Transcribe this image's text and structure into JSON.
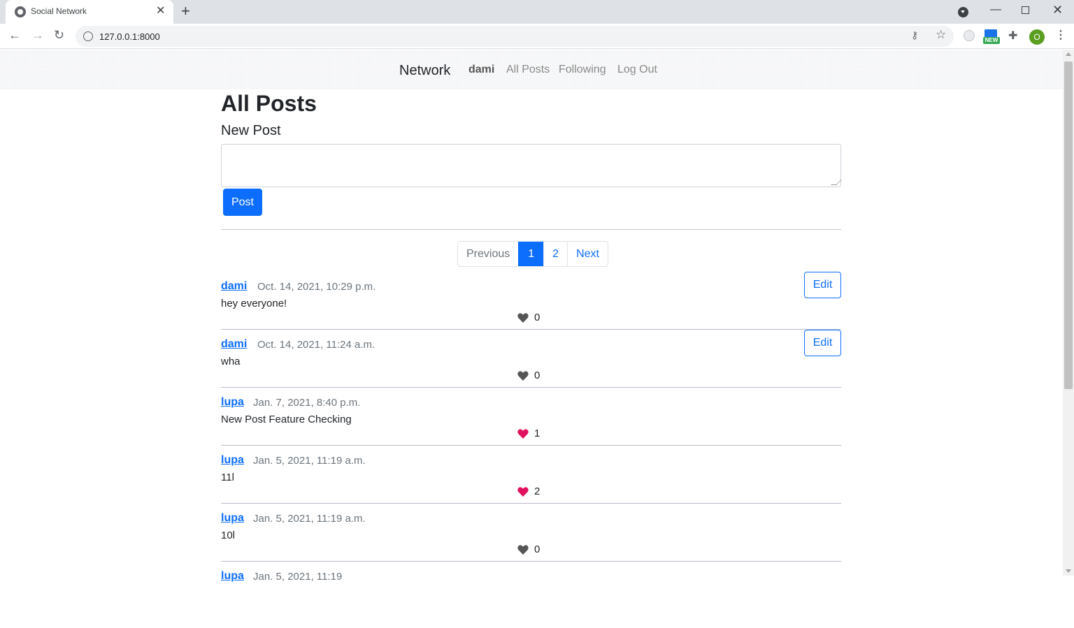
{
  "browser": {
    "tab_title": "Social Network",
    "tab_close": "✕",
    "new_tab": "+",
    "url": "127.0.0.1:8000",
    "ext_new_label": "NEW",
    "profile_initial": "O"
  },
  "navbar": {
    "brand": "Network",
    "user": "dami",
    "links": [
      "All Posts",
      "Following",
      "Log Out"
    ]
  },
  "page": {
    "title": "All Posts",
    "new_post_heading": "New Post",
    "textarea_value": "",
    "post_button": "Post"
  },
  "pagination": {
    "previous": "Previous",
    "pages": [
      "1",
      "2"
    ],
    "active_page": "1",
    "next": "Next"
  },
  "posts": [
    {
      "author": "dami",
      "date": "Oct. 14, 2021, 10:29 p.m.",
      "content": "hey everyone!",
      "likes": "0",
      "liked": false,
      "editable": true,
      "edit_label": "Edit"
    },
    {
      "author": "dami",
      "date": "Oct. 14, 2021, 11:24 a.m.",
      "content": "wha",
      "likes": "0",
      "liked": false,
      "editable": true,
      "edit_label": "Edit"
    },
    {
      "author": "lupa",
      "date": "Jan. 7, 2021, 8:40 p.m.",
      "content": "New Post Feature Checking",
      "likes": "1",
      "liked": true,
      "editable": false
    },
    {
      "author": "lupa",
      "date": "Jan. 5, 2021, 11:19 a.m.",
      "content": "11l",
      "likes": "2",
      "liked": true,
      "editable": false
    },
    {
      "author": "lupa",
      "date": "Jan. 5, 2021, 11:19 a.m.",
      "content": "10l",
      "likes": "0",
      "liked": false,
      "editable": false
    },
    {
      "author": "lupa",
      "date": "Jan. 5, 2021, 11:19",
      "content": "",
      "likes": "",
      "liked": false,
      "editable": false
    }
  ],
  "colors": {
    "primary": "#0d6efd",
    "heart_liked": "#e0115f",
    "heart_unliked": "#555555"
  },
  "icons": {
    "heart_liked": "heart-filled-red",
    "heart_unliked": "heart-filled-grey"
  }
}
